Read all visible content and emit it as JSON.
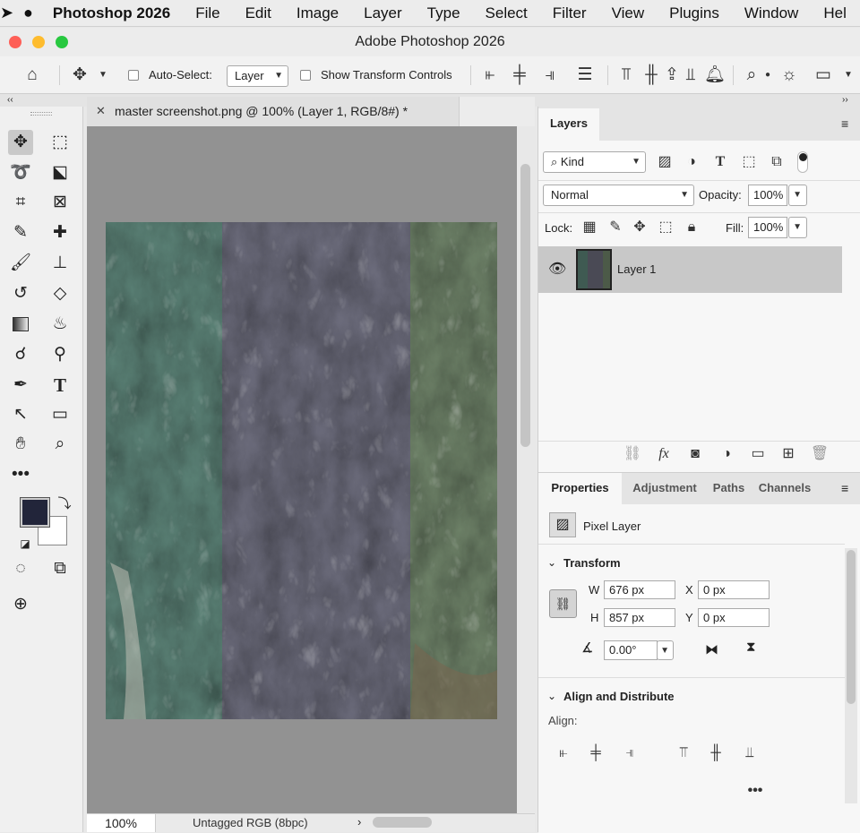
{
  "menubar": {
    "apple": "",
    "app": "Photoshop 2026",
    "items": [
      "File",
      "Edit",
      "Image",
      "Layer",
      "Type",
      "Select",
      "Filter",
      "View",
      "Plugins",
      "Window",
      "Hel"
    ]
  },
  "window": {
    "title": "Adobe Photoshop 2026"
  },
  "options": {
    "auto_select_label": "Auto-Select:",
    "auto_select_value": "Layer",
    "show_transform_label": "Show Transform Controls"
  },
  "document": {
    "tab_title": "master screenshot.png @ 100% (Layer 1, RGB/8#) *",
    "zoom": "100%",
    "color_profile": "Untagged RGB (8bpc)"
  },
  "layers_panel": {
    "tab": "Layers",
    "filter_kind": "Kind",
    "blend_mode": "Normal",
    "opacity_label": "Opacity:",
    "opacity_value": "100%",
    "lock_label": "Lock:",
    "fill_label": "Fill:",
    "fill_value": "100%",
    "layers": [
      {
        "name": "Layer 1",
        "visible": true
      }
    ]
  },
  "properties_panel": {
    "tabs": [
      "Properties",
      "Adjustment",
      "Paths",
      "Channels"
    ],
    "layer_type": "Pixel Layer",
    "transform_title": "Transform",
    "w_label": "W",
    "w_value": "676 px",
    "h_label": "H",
    "h_value": "857 px",
    "x_label": "X",
    "x_value": "0 px",
    "y_label": "Y",
    "y_value": "0 px",
    "angle_value": "0.00°",
    "align_title": "Align and Distribute",
    "align_label": "Align:"
  },
  "colors": {
    "foreground": "#22253a",
    "background": "#ffffff"
  }
}
